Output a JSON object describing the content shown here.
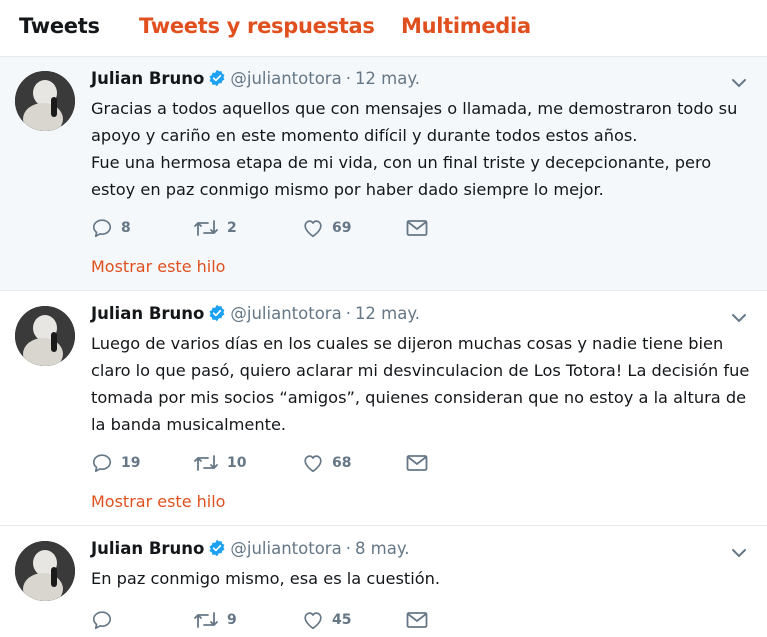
{
  "tabs": [
    {
      "label": "Tweets"
    },
    {
      "label": "Tweets y respuestas"
    },
    {
      "label": "Multimedia"
    }
  ],
  "colors": {
    "accent": "#e0501f",
    "verified": "#1da1f2",
    "muted": "#657786",
    "highlight_bg": "#f5f8fa"
  },
  "tweets": [
    {
      "name": "Julian Bruno",
      "handle": "@juliantotora",
      "separator": "·",
      "date": "12 may.",
      "lines": [
        "Gracias a todos aquellos que con mensajes o llamada, me demostraron todo su apoyo y cariño en este momento difícil y durante todos estos años.",
        "Fue una hermosa etapa de mi vida, con un final triste y decepcionante, pero estoy en paz conmigo mismo por haber dado siempre lo mejor."
      ],
      "replies": "8",
      "retweets": "2",
      "likes": "69",
      "thread_label": "Mostrar este hilo"
    },
    {
      "name": "Julian Bruno",
      "handle": "@juliantotora",
      "separator": "·",
      "date": "12 may.",
      "lines": [
        "Luego de varios días en los cuales se dijeron muchas cosas y nadie tiene bien claro lo que pasó, quiero aclarar mi desvinculacion de Los Totora! La decisión fue tomada por mis socios “amigos”, quienes consideran que no estoy a la altura de la banda musicalmente."
      ],
      "replies": "19",
      "retweets": "10",
      "likes": "68",
      "thread_label": "Mostrar este hilo"
    },
    {
      "name": "Julian Bruno",
      "handle": "@juliantotora",
      "separator": "·",
      "date": "8 may.",
      "lines": [
        "En paz conmigo mismo, esa es la cuestión."
      ],
      "replies": "",
      "retweets": "9",
      "likes": "45"
    }
  ],
  "icons": {
    "avatar": "avatar",
    "verified": "verified-badge-icon",
    "chevron": "chevron-down-icon",
    "reply": "reply-icon",
    "retweet": "retweet-icon",
    "like": "heart-icon",
    "dm": "envelope-icon"
  }
}
